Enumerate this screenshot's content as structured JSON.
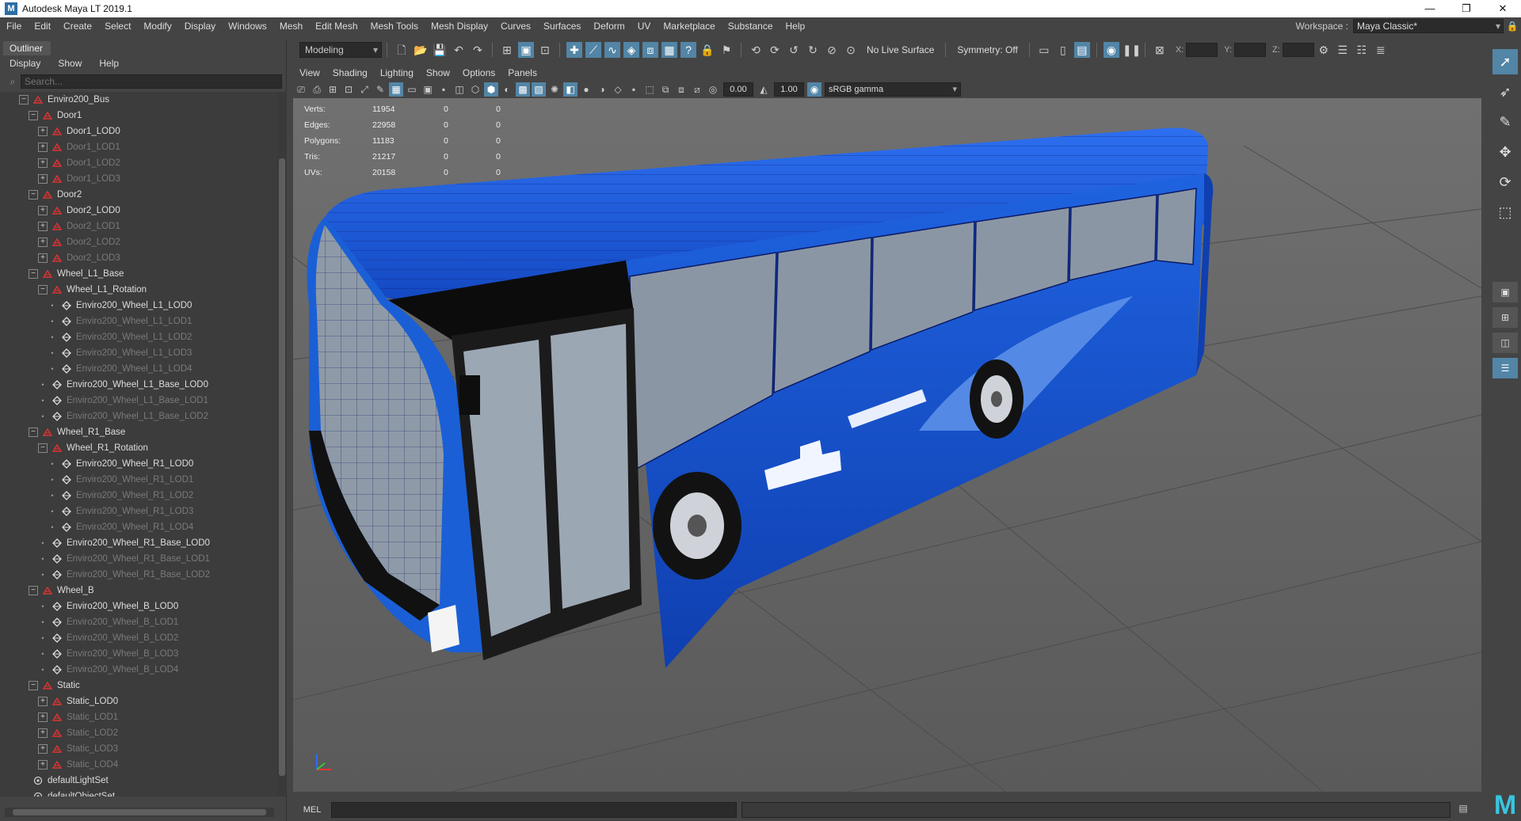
{
  "window": {
    "title": "Autodesk Maya LT 2019.1",
    "logo": "M",
    "minimize": "—",
    "restore": "❐",
    "close": "✕"
  },
  "menu": {
    "items": [
      "File",
      "Edit",
      "Create",
      "Select",
      "Modify",
      "Display",
      "Windows",
      "Mesh",
      "Edit Mesh",
      "Mesh Tools",
      "Mesh Display",
      "Curves",
      "Surfaces",
      "Deform",
      "UV",
      "Marketplace",
      "Substance",
      "Help"
    ],
    "workspace_label": "Workspace :",
    "workspace_value": "Maya Classic*"
  },
  "outliner": {
    "tab": "Outliner",
    "menu": [
      "Display",
      "Show",
      "Help"
    ],
    "search_placeholder": "Search...",
    "rows": [
      {
        "label": "Enviro200_Bus",
        "depth": 0,
        "exp": "minus",
        "icon": "transform",
        "dim": false
      },
      {
        "label": "Door1",
        "depth": 1,
        "exp": "minus",
        "icon": "transform",
        "dim": false
      },
      {
        "label": "Door1_LOD0",
        "depth": 2,
        "exp": "plus",
        "icon": "transform",
        "dim": false
      },
      {
        "label": "Door1_LOD1",
        "depth": 2,
        "exp": "plus",
        "icon": "transform",
        "dim": true
      },
      {
        "label": "Door1_LOD2",
        "depth": 2,
        "exp": "plus",
        "icon": "transform",
        "dim": true
      },
      {
        "label": "Door1_LOD3",
        "depth": 2,
        "exp": "plus",
        "icon": "transform",
        "dim": true
      },
      {
        "label": "Door2",
        "depth": 1,
        "exp": "minus",
        "icon": "transform",
        "dim": false
      },
      {
        "label": "Door2_LOD0",
        "depth": 2,
        "exp": "plus",
        "icon": "transform",
        "dim": false
      },
      {
        "label": "Door2_LOD1",
        "depth": 2,
        "exp": "plus",
        "icon": "transform",
        "dim": true
      },
      {
        "label": "Door2_LOD2",
        "depth": 2,
        "exp": "plus",
        "icon": "transform",
        "dim": true
      },
      {
        "label": "Door2_LOD3",
        "depth": 2,
        "exp": "plus",
        "icon": "transform",
        "dim": true
      },
      {
        "label": "Wheel_L1_Base",
        "depth": 1,
        "exp": "minus",
        "icon": "transform",
        "dim": false
      },
      {
        "label": "Wheel_L1_Rotation",
        "depth": 2,
        "exp": "minus",
        "icon": "transform",
        "dim": false
      },
      {
        "label": "Enviro200_Wheel_L1_LOD0",
        "depth": 3,
        "exp": "none",
        "icon": "mesh",
        "dim": false
      },
      {
        "label": "Enviro200_Wheel_L1_LOD1",
        "depth": 3,
        "exp": "none",
        "icon": "mesh",
        "dim": true
      },
      {
        "label": "Enviro200_Wheel_L1_LOD2",
        "depth": 3,
        "exp": "none",
        "icon": "mesh",
        "dim": true
      },
      {
        "label": "Enviro200_Wheel_L1_LOD3",
        "depth": 3,
        "exp": "none",
        "icon": "mesh",
        "dim": true
      },
      {
        "label": "Enviro200_Wheel_L1_LOD4",
        "depth": 3,
        "exp": "none",
        "icon": "mesh",
        "dim": true
      },
      {
        "label": "Enviro200_Wheel_L1_Base_LOD0",
        "depth": 2,
        "exp": "none",
        "icon": "mesh",
        "dim": false
      },
      {
        "label": "Enviro200_Wheel_L1_Base_LOD1",
        "depth": 2,
        "exp": "none",
        "icon": "mesh",
        "dim": true
      },
      {
        "label": "Enviro200_Wheel_L1_Base_LOD2",
        "depth": 2,
        "exp": "none",
        "icon": "mesh",
        "dim": true
      },
      {
        "label": "Wheel_R1_Base",
        "depth": 1,
        "exp": "minus",
        "icon": "transform",
        "dim": false
      },
      {
        "label": "Wheel_R1_Rotation",
        "depth": 2,
        "exp": "minus",
        "icon": "transform",
        "dim": false
      },
      {
        "label": "Enviro200_Wheel_R1_LOD0",
        "depth": 3,
        "exp": "none",
        "icon": "mesh",
        "dim": false
      },
      {
        "label": "Enviro200_Wheel_R1_LOD1",
        "depth": 3,
        "exp": "none",
        "icon": "mesh",
        "dim": true
      },
      {
        "label": "Enviro200_Wheel_R1_LOD2",
        "depth": 3,
        "exp": "none",
        "icon": "mesh",
        "dim": true
      },
      {
        "label": "Enviro200_Wheel_R1_LOD3",
        "depth": 3,
        "exp": "none",
        "icon": "mesh",
        "dim": true
      },
      {
        "label": "Enviro200_Wheel_R1_LOD4",
        "depth": 3,
        "exp": "none",
        "icon": "mesh",
        "dim": true
      },
      {
        "label": "Enviro200_Wheel_R1_Base_LOD0",
        "depth": 2,
        "exp": "none",
        "icon": "mesh",
        "dim": false
      },
      {
        "label": "Enviro200_Wheel_R1_Base_LOD1",
        "depth": 2,
        "exp": "none",
        "icon": "mesh",
        "dim": true
      },
      {
        "label": "Enviro200_Wheel_R1_Base_LOD2",
        "depth": 2,
        "exp": "none",
        "icon": "mesh",
        "dim": true
      },
      {
        "label": "Wheel_B",
        "depth": 1,
        "exp": "minus",
        "icon": "transform",
        "dim": false
      },
      {
        "label": "Enviro200_Wheel_B_LOD0",
        "depth": 2,
        "exp": "none",
        "icon": "mesh",
        "dim": false
      },
      {
        "label": "Enviro200_Wheel_B_LOD1",
        "depth": 2,
        "exp": "none",
        "icon": "mesh",
        "dim": true
      },
      {
        "label": "Enviro200_Wheel_B_LOD2",
        "depth": 2,
        "exp": "none",
        "icon": "mesh",
        "dim": true
      },
      {
        "label": "Enviro200_Wheel_B_LOD3",
        "depth": 2,
        "exp": "none",
        "icon": "mesh",
        "dim": true
      },
      {
        "label": "Enviro200_Wheel_B_LOD4",
        "depth": 2,
        "exp": "none",
        "icon": "mesh",
        "dim": true
      },
      {
        "label": "Static",
        "depth": 1,
        "exp": "minus",
        "icon": "transform",
        "dim": false
      },
      {
        "label": "Static_LOD0",
        "depth": 2,
        "exp": "plus",
        "icon": "transform",
        "dim": false
      },
      {
        "label": "Static_LOD1",
        "depth": 2,
        "exp": "plus",
        "icon": "transform",
        "dim": true
      },
      {
        "label": "Static_LOD2",
        "depth": 2,
        "exp": "plus",
        "icon": "transform",
        "dim": true
      },
      {
        "label": "Static_LOD3",
        "depth": 2,
        "exp": "plus",
        "icon": "transform",
        "dim": true
      },
      {
        "label": "Static_LOD4",
        "depth": 2,
        "exp": "plus",
        "icon": "transform",
        "dim": true
      },
      {
        "label": "defaultLightSet",
        "depth": 0,
        "exp": "none",
        "icon": "set",
        "dim": false
      },
      {
        "label": "defaultObjectSet",
        "depth": 0,
        "exp": "none",
        "icon": "set",
        "dim": false
      }
    ]
  },
  "statusline": {
    "mode": "Modeling",
    "live_surface": "No Live Surface",
    "symmetry": "Symmetry: Off",
    "coord_labels": [
      "X:",
      "Y:",
      "Z:"
    ]
  },
  "viewport": {
    "menu": [
      "View",
      "Shading",
      "Lighting",
      "Show",
      "Options",
      "Panels"
    ],
    "exposure": "0.00",
    "gamma": "1.00",
    "colorspace": "sRGB gamma",
    "hud": [
      {
        "label": "Verts:",
        "a": "11954",
        "b": "0",
        "c": "0"
      },
      {
        "label": "Edges:",
        "a": "22958",
        "b": "0",
        "c": "0"
      },
      {
        "label": "Polygons:",
        "a": "11183",
        "b": "0",
        "c": "0"
      },
      {
        "label": "Tris:",
        "a": "21217",
        "b": "0",
        "c": "0"
      },
      {
        "label": "UVs:",
        "a": "20158",
        "b": "0",
        "c": "0"
      }
    ],
    "colors": {
      "bus_blue": "#1a5fd6",
      "bus_dark_blue": "#0b2f7a",
      "wire": "#0a1a66",
      "window": "#9aa6b4"
    }
  },
  "cmdline": {
    "label": "MEL"
  },
  "accent": "#5285a6",
  "maya_logo": "M"
}
